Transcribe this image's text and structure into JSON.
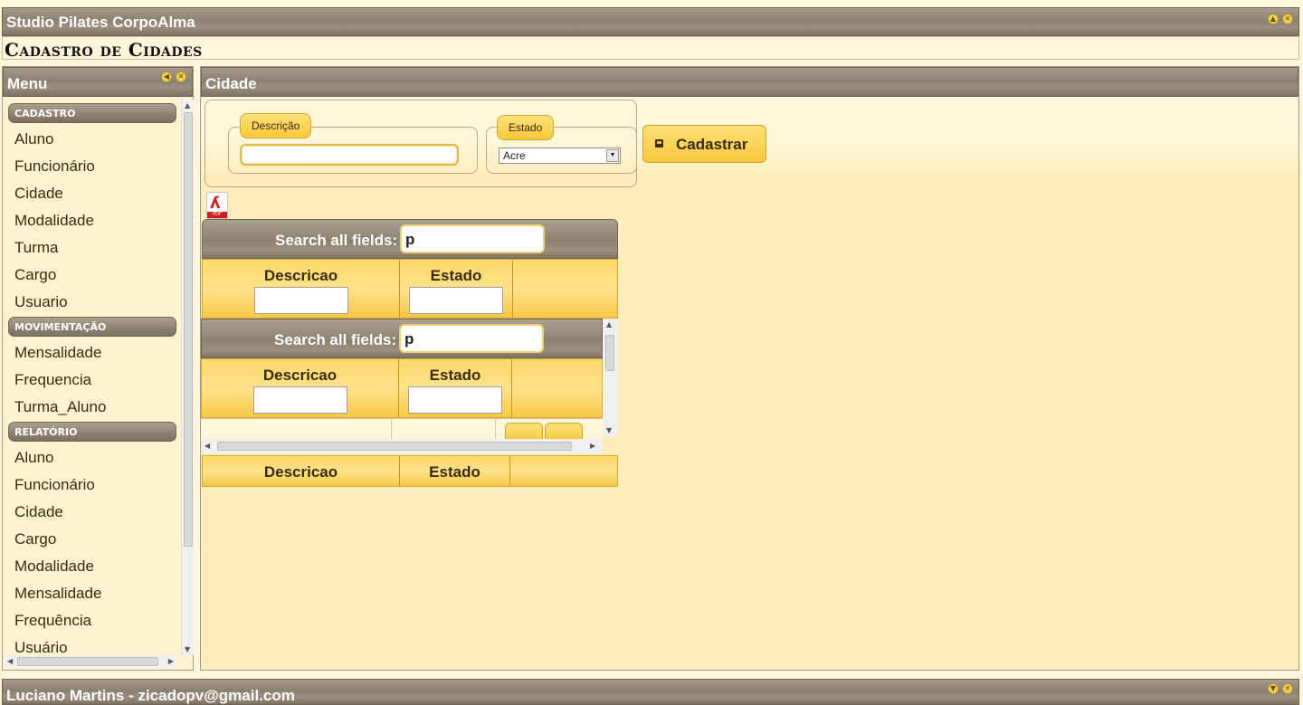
{
  "app": {
    "title": "Studio Pilates CorpoAlma",
    "page_title": "Cadastro de Cidades"
  },
  "sidebar": {
    "title": "Menu",
    "sections": [
      {
        "label": "CADASTRO",
        "items": [
          "Aluno",
          "Funcionário",
          "Cidade",
          "Modalidade",
          "Turma",
          "Cargo",
          "Usuario"
        ]
      },
      {
        "label": "MOVIMENTAÇÃO",
        "items": [
          "Mensalidade",
          "Frequencia",
          "Turma_Aluno"
        ]
      },
      {
        "label": "RELATÓRIO",
        "items": [
          "Aluno",
          "Funcionário",
          "Cidade",
          "Cargo",
          "Modalidade",
          "Mensalidade",
          "Frequência",
          "Usuário"
        ]
      }
    ]
  },
  "main": {
    "title": "Cidade",
    "form": {
      "descricao_legend": "Descrição",
      "descricao_value": "",
      "estado_legend": "Estado",
      "estado_selected": "Acre",
      "submit_label": "Cadastrar"
    },
    "grid": {
      "search_label": "Search all fields:",
      "search_value": "p",
      "columns": [
        "Descricao",
        "Estado"
      ]
    }
  },
  "footer": {
    "user": "Luciano Martins - zicadopv@gmail.com"
  },
  "icons": [
    "minimize-icon",
    "close-icon",
    "save-icon",
    "pdf-icon",
    "dropdown-arrow-icon"
  ],
  "colors": {
    "header": "#8b8170",
    "accent": "#f7c83a",
    "background": "#fff7dc"
  }
}
